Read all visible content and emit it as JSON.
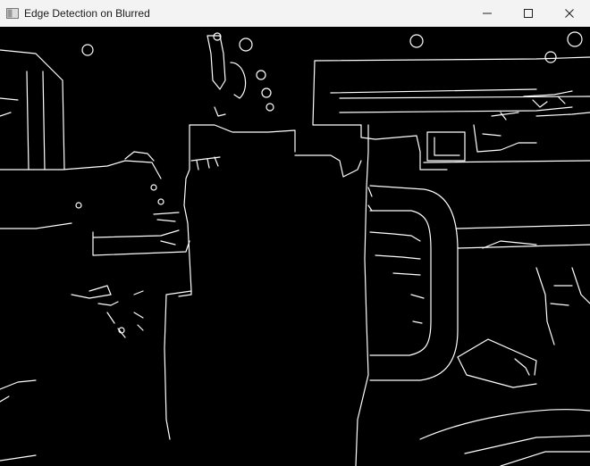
{
  "window": {
    "title": "Edge Detection on Blurred",
    "icon": "app-window-icon",
    "controls": [
      {
        "name": "minimize-button",
        "icon": "minimize-icon"
      },
      {
        "name": "maximize-button",
        "icon": "maximize-icon"
      },
      {
        "name": "close-button",
        "icon": "close-icon"
      }
    ]
  },
  "image": {
    "description_colors": {
      "background": "#000000",
      "edges": "#ffffff"
    }
  }
}
